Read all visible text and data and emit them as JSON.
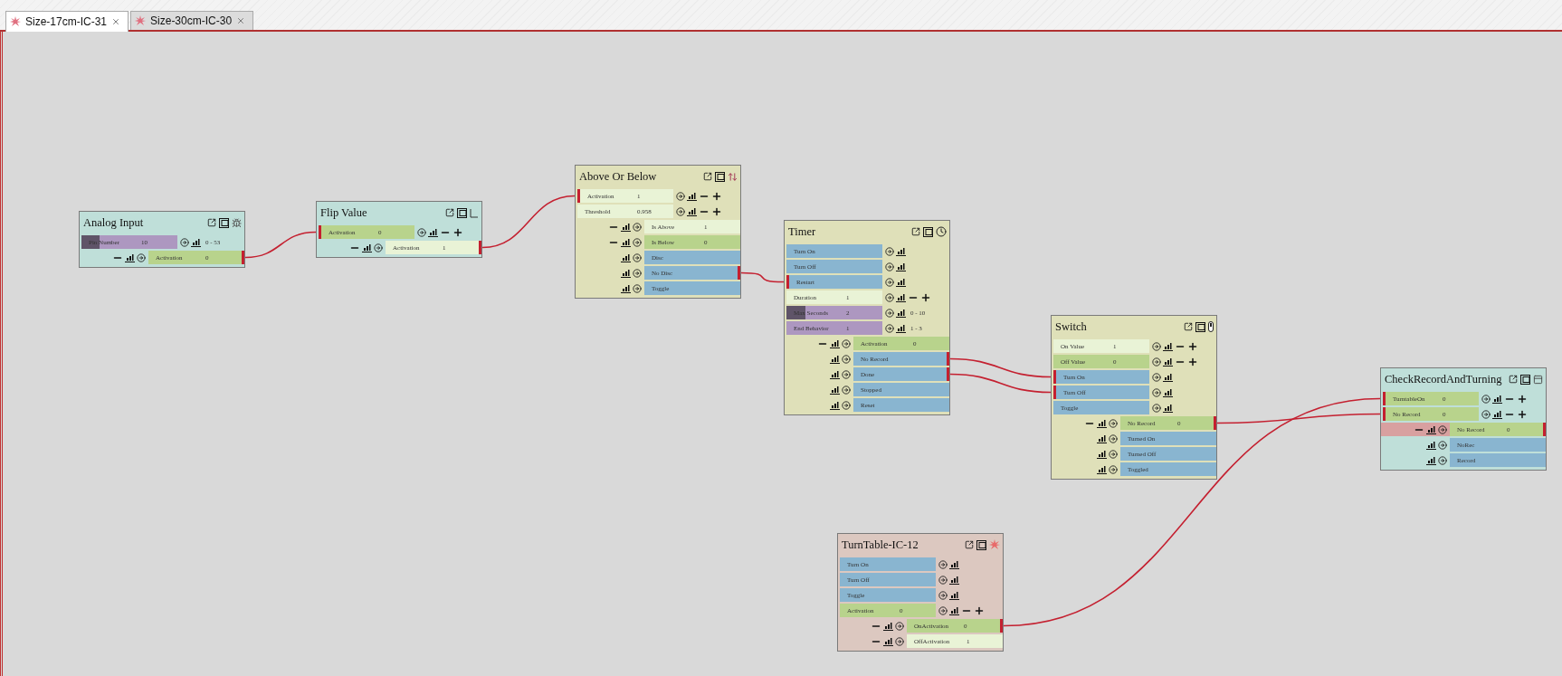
{
  "tabs": [
    {
      "label": "Size-17cm-IC-31",
      "selected": true
    },
    {
      "label": "Size-30cm-IC-30",
      "selected": false
    }
  ],
  "nodes": [
    {
      "title": "Analog Input",
      "kind": "sensor",
      "color": "#bfdfd9",
      "inputs": [
        {
          "kind": "range",
          "label": "Pin Number",
          "value": "10",
          "range": "0 - 53",
          "level": 0.19,
          "connected": false
        }
      ],
      "outputs": [
        {
          "kind": "number",
          "label": "Activation",
          "value": "0",
          "active": false,
          "connected": true
        }
      ]
    },
    {
      "title": "Flip Value",
      "kind": "flip",
      "color": "#bfdfd9",
      "inputs": [
        {
          "kind": "number",
          "label": "Activation",
          "value": "0",
          "active": false,
          "connected": true
        }
      ],
      "outputs": [
        {
          "kind": "number",
          "label": "Activation",
          "value": "1",
          "active": true,
          "connected": true
        }
      ]
    },
    {
      "title": "Above Or Below",
      "kind": "compare",
      "color": "#dfe0b9",
      "inputs": [
        {
          "kind": "number",
          "label": "Activation",
          "value": "1",
          "active": true,
          "connected": true
        },
        {
          "kind": "number",
          "label": "Threshold",
          "value": "0.958",
          "active": true,
          "connected": false
        }
      ],
      "outputs": [
        {
          "kind": "number",
          "label": "Is Above",
          "value": "1",
          "active": true,
          "connected": false
        },
        {
          "kind": "number",
          "label": "Is Below",
          "value": "0",
          "active": false,
          "connected": false
        },
        {
          "kind": "trigger",
          "label": "Disc",
          "connected": false
        },
        {
          "kind": "trigger",
          "label": "No Disc",
          "connected": true
        },
        {
          "kind": "trigger",
          "label": "Toggle",
          "connected": false
        }
      ]
    },
    {
      "title": "Timer",
      "kind": "timer",
      "color": "#dfe0b9",
      "inputs": [
        {
          "kind": "trigger",
          "label": "Turn On",
          "connected": false
        },
        {
          "kind": "trigger",
          "label": "Turn Off",
          "connected": false
        },
        {
          "kind": "trigger",
          "label": "Restart",
          "connected": true
        },
        {
          "kind": "number",
          "label": "Duration",
          "value": "1",
          "active": true,
          "connected": false
        },
        {
          "kind": "range",
          "label": "Max Seconds",
          "value": "2",
          "range": "0 - 10",
          "level": 0.2,
          "connected": false
        },
        {
          "kind": "range",
          "label": "End Behavior",
          "value": "1",
          "range": "1 - 3",
          "level": 0,
          "connected": false
        }
      ],
      "outputs": [
        {
          "kind": "number",
          "label": "Activation",
          "value": "0",
          "active": false,
          "connected": false
        },
        {
          "kind": "trigger",
          "label": "No Record",
          "connected": true
        },
        {
          "kind": "trigger",
          "label": "Done",
          "connected": true
        },
        {
          "kind": "trigger",
          "label": "Stopped",
          "connected": false
        },
        {
          "kind": "trigger",
          "label": "Reset",
          "connected": false
        }
      ]
    },
    {
      "title": "Switch",
      "kind": "switch",
      "color": "#dfe0b9",
      "inputs": [
        {
          "kind": "number",
          "label": "On Value",
          "value": "1",
          "active": true,
          "connected": false
        },
        {
          "kind": "number",
          "label": "Off Value",
          "value": "0",
          "active": false,
          "connected": false
        },
        {
          "kind": "trigger",
          "label": "Turn On",
          "connected": true
        },
        {
          "kind": "trigger",
          "label": "Turn Off",
          "connected": true
        },
        {
          "kind": "trigger",
          "label": "Toggle",
          "connected": false
        }
      ],
      "outputs": [
        {
          "kind": "number",
          "label": "No Record",
          "value": "0",
          "active": false,
          "connected": true
        },
        {
          "kind": "trigger",
          "label": "Turned On",
          "connected": false
        },
        {
          "kind": "trigger",
          "label": "Turned Off",
          "connected": false
        },
        {
          "kind": "trigger",
          "label": "Toggled",
          "connected": false
        }
      ]
    },
    {
      "title": "CheckRecordAndTurning",
      "kind": "script",
      "color": "#bfdfd9",
      "inputs": [
        {
          "kind": "number",
          "label": "TurntableOn",
          "value": "0",
          "active": false,
          "connected": true
        },
        {
          "kind": "number",
          "label": "No Record",
          "value": "0",
          "active": false,
          "connected": true
        }
      ],
      "outputs": [
        {
          "kind": "number",
          "label": "No Record",
          "value": "0",
          "active": false,
          "connected": true,
          "alert": true
        },
        {
          "kind": "trigger",
          "label": "NoRec",
          "connected": false
        },
        {
          "kind": "trigger",
          "label": "Record",
          "connected": false
        }
      ]
    },
    {
      "title": "TurnTable-IC-12",
      "kind": "chip",
      "color": "#dcc8c0",
      "inputs": [
        {
          "kind": "trigger",
          "label": "Turn On",
          "connected": false
        },
        {
          "kind": "trigger",
          "label": "Turn Off",
          "connected": false
        },
        {
          "kind": "trigger",
          "label": "Toggle",
          "connected": false
        },
        {
          "kind": "number",
          "label": "Activation",
          "value": "0",
          "active": false,
          "connected": false
        }
      ],
      "outputs": [
        {
          "kind": "number",
          "label": "OnActivation",
          "value": "0",
          "active": false,
          "connected": true
        },
        {
          "kind": "number",
          "label": "OffActivation",
          "value": "1",
          "active": true,
          "connected": false
        }
      ]
    }
  ]
}
